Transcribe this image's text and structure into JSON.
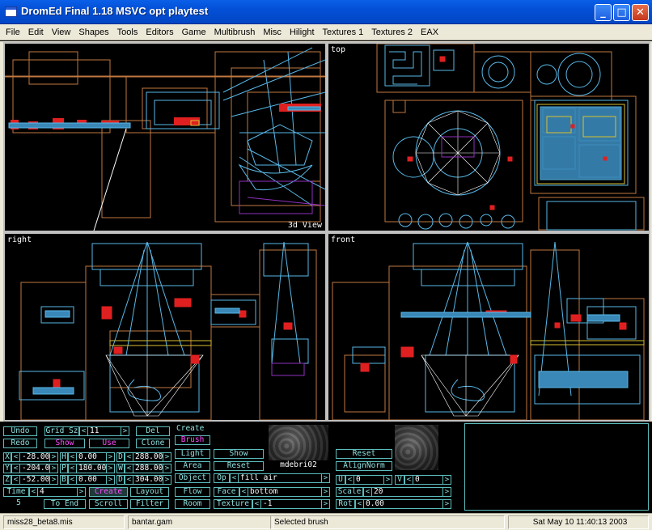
{
  "window": {
    "title": "DromEd Final 1.18 MSVC opt playtest",
    "controls": {
      "minimize": "_",
      "maximize": "□",
      "close": "✕"
    }
  },
  "menu": [
    "File",
    "Edit",
    "View",
    "Shapes",
    "Tools",
    "Editors",
    "Game",
    "Multibrush",
    "Misc",
    "Hilight",
    "Textures 1",
    "Textures 2",
    "EAX"
  ],
  "viewports": {
    "perspective": "3d View",
    "top": "top",
    "right": "right",
    "front": "front"
  },
  "colors": {
    "wire_cyan": "#58b8e8",
    "wire_orange": "#c07840",
    "wire_red": "#e02020",
    "wire_purple": "#9030c0",
    "wire_yellow": "#d8c030",
    "panel_cyan": "#5cbcbc",
    "panel_magenta": "#ff4cff"
  },
  "panel": {
    "undo": "Undo",
    "redo": "Redo",
    "grid_sz_label": "Grid Sz",
    "grid_sz": "11",
    "show": "Show",
    "use": "Use",
    "del": "Del",
    "clone": "Clone",
    "create_label": "Create",
    "brush": "Brush",
    "light": "Light",
    "area": "Area",
    "object": "Object",
    "flow": "Flow",
    "room": "Room",
    "layout": "Layout",
    "filter": "Filter",
    "create_btn": "Create",
    "scroll": "Scroll",
    "to_end": "To End",
    "time_label": "Time",
    "time": "4",
    "frame": "5",
    "x_label": "X",
    "x": "-28.00",
    "y_label": "Y",
    "y": "-204.00",
    "z_label": "Z",
    "z": "-52.00",
    "h_label": "H",
    "h": "0.00",
    "p_label": "P",
    "p": "180.00",
    "b_label": "B",
    "b": "0.00",
    "d_label": "D",
    "d": "288.00",
    "w_label": "W",
    "w": "288.00",
    "dz_label": "D",
    "dz": "304.00",
    "show2": "Show",
    "reset": "Reset",
    "texture_name": "mdebri02",
    "op_label": "Op",
    "op": "fill air",
    "face_label": "Face",
    "face": "bottom",
    "texture_label": "Texture",
    "texture": "-1",
    "reset2": "Reset",
    "align_norm": "AlignNorm",
    "u_label": "U",
    "u": "0",
    "v_label": "V",
    "v": "0",
    "scale_label": "Scale",
    "scale": "20",
    "rot_label": "Rot",
    "rot": "0.00"
  },
  "status": {
    "mission": "miss28_beta8.mis",
    "gamesys": "bantar.gam",
    "message": "Selected brush",
    "datetime": "Sat May 10 11:40:13 2003"
  }
}
